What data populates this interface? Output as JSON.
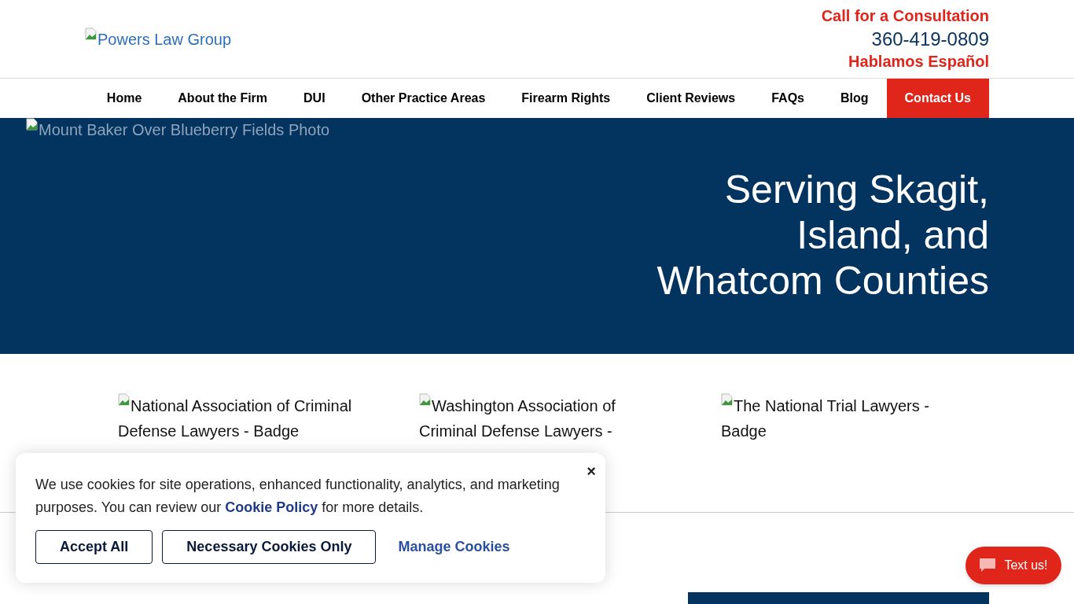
{
  "header": {
    "logo_alt": "Powers Law Group",
    "cta": "Call for a Consultation",
    "phone": "360-419-0809",
    "spanish": "Hablamos Español"
  },
  "nav": [
    {
      "label": "Home",
      "selected": false
    },
    {
      "label": "About the Firm",
      "selected": false
    },
    {
      "label": "DUI",
      "selected": false
    },
    {
      "label": "Other Practice Areas",
      "selected": false
    },
    {
      "label": "Firearm Rights",
      "selected": false
    },
    {
      "label": "Client Reviews",
      "selected": false
    },
    {
      "label": "FAQs",
      "selected": false
    },
    {
      "label": "Blog",
      "selected": false
    },
    {
      "label": "Contact Us",
      "selected": true
    }
  ],
  "hero": {
    "image_alt": "Mount Baker Over Blueberry Fields Photo",
    "heading_lines": [
      "Serving Skagit,",
      "Island, and",
      "Whatcom Counties"
    ]
  },
  "badges": [
    {
      "alt": "National Association of Criminal Defense Lawyers - Badge"
    },
    {
      "alt": "Washington Association of Criminal Defense Lawyers -"
    },
    {
      "alt": "The National Trial Lawyers - Badge"
    }
  ],
  "cookie_banner": {
    "text_before": "We use cookies for site operations, enhanced functionality, analytics, and marketing purposes. You can review our",
    "link": "Cookie Policy",
    "text_after": "for more details.",
    "close": "×",
    "buttons": [
      "Accept All",
      "Necessary Cookies Only"
    ],
    "manage": "Manage Cookies"
  },
  "chat_button": {
    "label": "Text us!"
  }
}
